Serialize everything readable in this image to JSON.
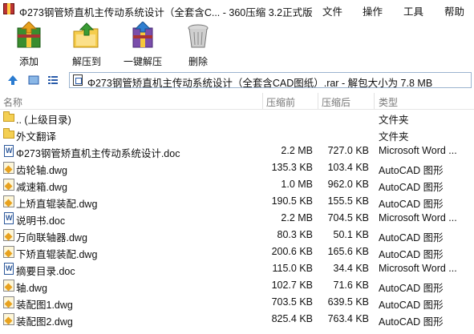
{
  "window": {
    "title": "Φ273钢管矫直机主传动系统设计（全套含C... - 360压缩 3.2正式版",
    "menu": [
      "文件",
      "操作",
      "工具",
      "帮助"
    ]
  },
  "toolbar": {
    "buttons": [
      {
        "label": "添加",
        "icon": "add-archive-icon"
      },
      {
        "label": "解压到",
        "icon": "extract-to-icon"
      },
      {
        "label": "一键解压",
        "icon": "one-click-extract-icon"
      },
      {
        "label": "删除",
        "icon": "delete-trash-icon"
      }
    ]
  },
  "address": {
    "path": "Φ273钢管矫直机主传动系统设计（全套含CAD图纸）.rar - 解包大小为 7.8 MB"
  },
  "columns": {
    "name": "名称",
    "packed": "压缩前",
    "compressed": "压缩后",
    "type": "类型"
  },
  "files": [
    {
      "name": ".. (上级目录)",
      "before": "",
      "after": "",
      "type": "文件夹",
      "icon": "folder-icon"
    },
    {
      "name": "外文翻译",
      "before": "",
      "after": "",
      "type": "文件夹",
      "icon": "folder-icon"
    },
    {
      "name": "Φ273钢管矫直机主传动系统设计.doc",
      "before": "2.2 MB",
      "after": "727.0 KB",
      "type": "Microsoft Word ...",
      "icon": "word-doc-icon"
    },
    {
      "name": "齿轮轴.dwg",
      "before": "135.3 KB",
      "after": "103.4 KB",
      "type": "AutoCAD 图形",
      "icon": "autocad-dwg-icon"
    },
    {
      "name": "减速箱.dwg",
      "before": "1.0 MB",
      "after": "962.0 KB",
      "type": "AutoCAD 图形",
      "icon": "autocad-dwg-icon"
    },
    {
      "name": "上矫直辊装配.dwg",
      "before": "190.5 KB",
      "after": "155.5 KB",
      "type": "AutoCAD 图形",
      "icon": "autocad-dwg-icon"
    },
    {
      "name": "说明书.doc",
      "before": "2.2 MB",
      "after": "704.5 KB",
      "type": "Microsoft Word ...",
      "icon": "word-doc-icon"
    },
    {
      "name": "万向联轴器.dwg",
      "before": "80.3 KB",
      "after": "50.1 KB",
      "type": "AutoCAD 图形",
      "icon": "autocad-dwg-icon"
    },
    {
      "name": "下矫直辊装配.dwg",
      "before": "200.6 KB",
      "after": "165.6 KB",
      "type": "AutoCAD 图形",
      "icon": "autocad-dwg-icon"
    },
    {
      "name": "摘要目录.doc",
      "before": "115.0 KB",
      "after": "34.4 KB",
      "type": "Microsoft Word ...",
      "icon": "word-doc-icon"
    },
    {
      "name": "轴.dwg",
      "before": "102.7 KB",
      "after": "71.6 KB",
      "type": "AutoCAD 图形",
      "icon": "autocad-dwg-icon"
    },
    {
      "name": "装配图1.dwg",
      "before": "703.5 KB",
      "after": "639.5 KB",
      "type": "AutoCAD 图形",
      "icon": "autocad-dwg-icon"
    },
    {
      "name": "装配图2.dwg",
      "before": "825.4 KB",
      "after": "763.4 KB",
      "type": "AutoCAD 图形",
      "icon": "autocad-dwg-icon"
    }
  ]
}
